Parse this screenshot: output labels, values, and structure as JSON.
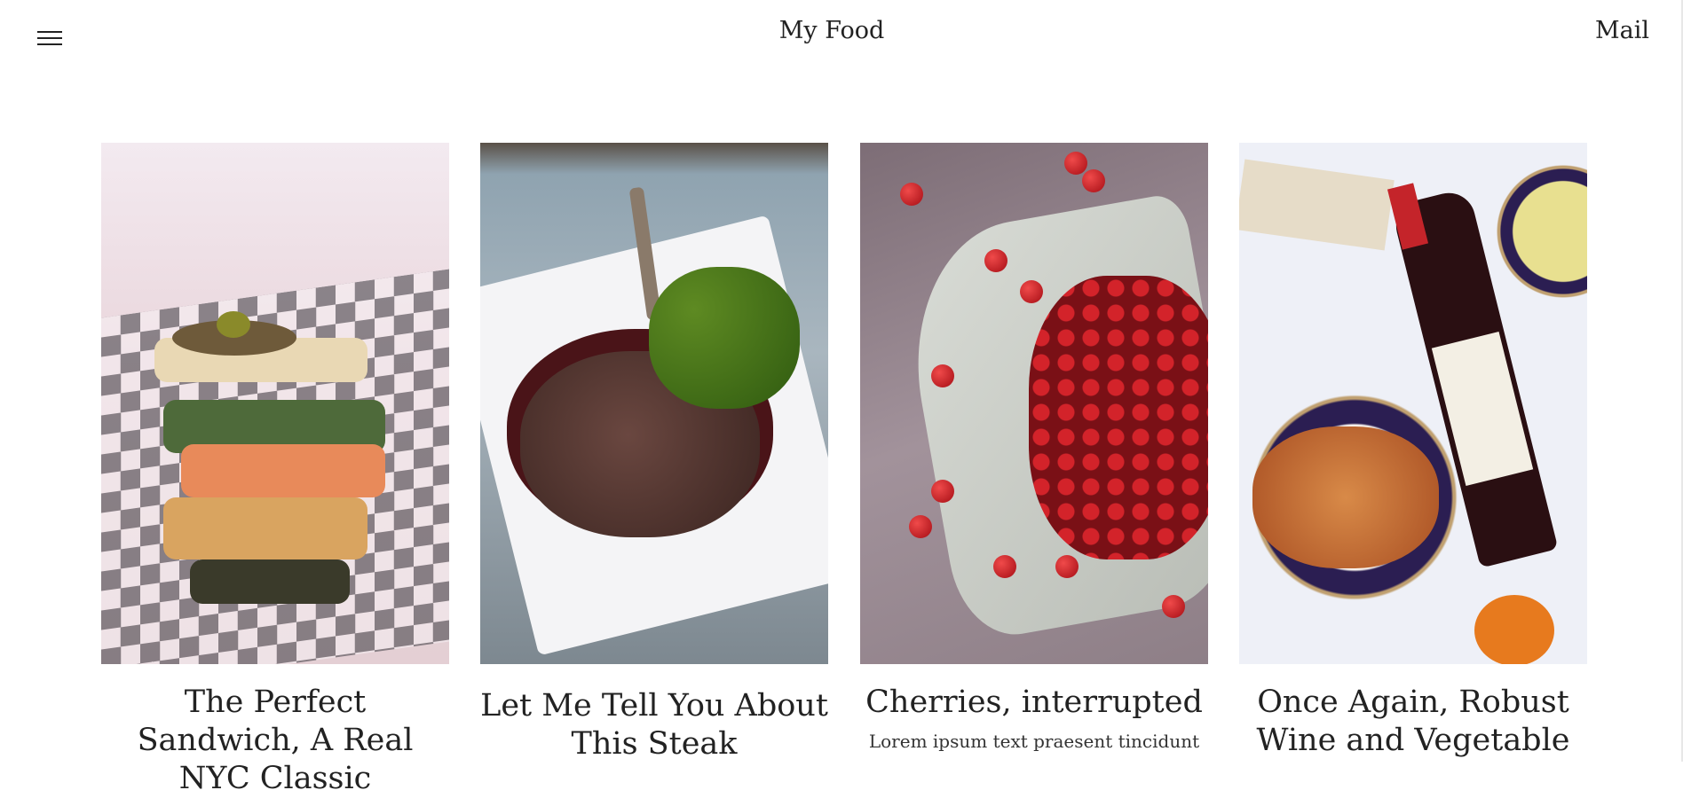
{
  "header": {
    "title": "My Food",
    "mail_label": "Mail",
    "menu_icon": "hamburger-menu-icon"
  },
  "cards": [
    {
      "title": "The Perfect Sandwich, A Real NYC Classic",
      "image": "sandwich-photo"
    },
    {
      "title": "Let Me Tell You About This Steak",
      "image": "steak-photo"
    },
    {
      "title": "Cherries, interrupted",
      "excerpt": "Lorem ipsum text praesent tincidunt",
      "image": "cherries-photo"
    },
    {
      "title": "Once Again, Robust Wine and Vegetable",
      "image": "wine-pasta-photo"
    }
  ]
}
